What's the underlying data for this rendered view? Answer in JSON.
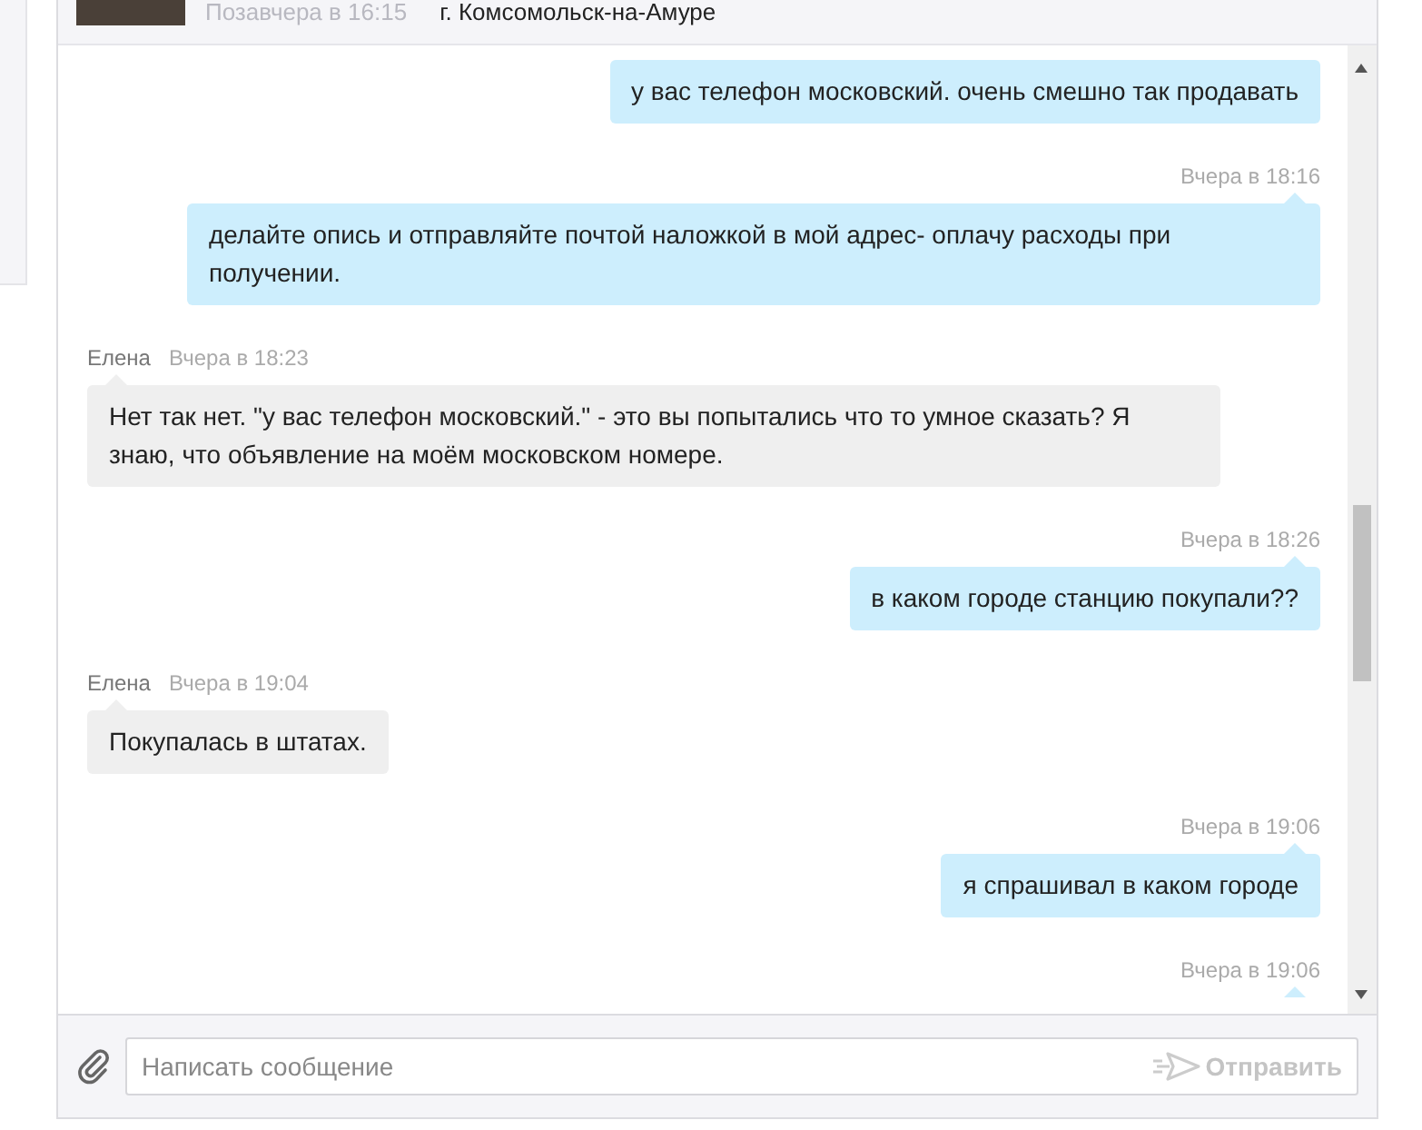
{
  "header": {
    "last_seen": "Позавчера в 16:15",
    "location": "г. Комсомольск-на-Амуре"
  },
  "messages": [
    {
      "kind": "outgoing",
      "text": "у вас телефон московский. очень смешно так продавать"
    },
    {
      "kind": "outgoing",
      "time": "Вчера в 18:16",
      "text": "делайте опись и отправляйте почтой наложкой в мой адрес- оплачу расходы при получении."
    },
    {
      "kind": "incoming",
      "author": "Елена",
      "time": "Вчера в 18:23",
      "text": "Нет так нет. \"у вас телефон московский.\" - это вы попытались что то умное сказать? Я знаю, что объявление на моём московском номере."
    },
    {
      "kind": "outgoing",
      "time": "Вчера в 18:26",
      "text": "в каком городе станцию покупали??"
    },
    {
      "kind": "incoming",
      "author": "Елена",
      "time": "Вчера в 19:04",
      "text": "Покупалась в штатах."
    },
    {
      "kind": "outgoing",
      "time": "Вчера в 19:06",
      "text": "я спрашивал в каком городе"
    },
    {
      "kind": "outgoing",
      "time": "Вчера в 19:06"
    }
  ],
  "composer": {
    "placeholder": "Написать сообщение",
    "send_label": "Отправить"
  }
}
